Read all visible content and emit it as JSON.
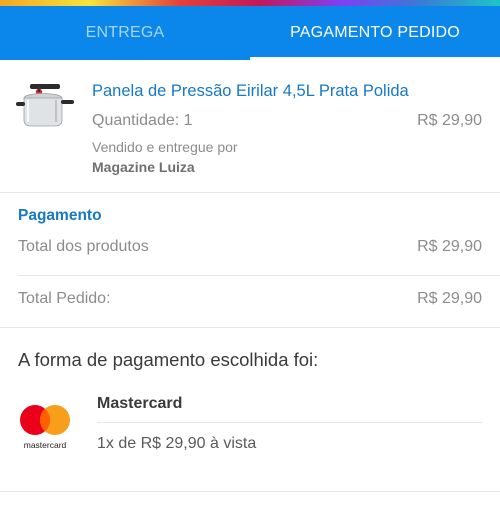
{
  "tabs": {
    "entrega": "ENTREGA",
    "pagamento_pedido": "PAGAMENTO PEDIDO",
    "active": "pagamento_pedido"
  },
  "product": {
    "icon": "pressure-cooker-image",
    "name": "Panela de Pressão Eirilar 4,5L Prata Polida",
    "quantity": "Quantidade: 1",
    "price": "R$ 29,90",
    "seller_label": "Vendido e entregue por",
    "seller_name": "Magazine Luiza"
  },
  "payment": {
    "title": "Pagamento",
    "total_products_label": "Total dos produtos",
    "total_products_value": "R$ 29,90",
    "total_order_label": "Total Pedido:",
    "total_order_value": "R$ 29,90"
  },
  "method": {
    "heading": "A forma de pagamento escolhida foi:",
    "card_brand": "Mastercard",
    "card_logo_text": "mastercard",
    "installment": "1x de R$ 29,90 à vista"
  },
  "colors": {
    "header_blue": "#0b86ea",
    "link_blue": "#1679c7",
    "mastercard_red": "#eb001b",
    "mastercard_orange": "#f79e1b"
  }
}
